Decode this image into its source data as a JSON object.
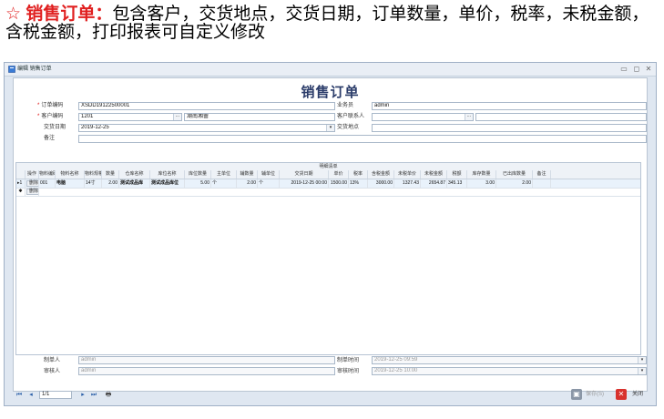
{
  "caption": {
    "star": "☆",
    "keyword": "销售订单：",
    "text": "包含客户，交货地点，交货日期，订单数量，单价，税率，未税金额，含税金额，打印报表可自定义修改"
  },
  "window": {
    "title": "编辑 销售订单",
    "form_title": "销售订单"
  },
  "fields": {
    "order_no_label": "订单编码",
    "order_no_value": "XSDD19122500001",
    "customer_code_label": "客户编码",
    "customer_code_value": "1201",
    "customer_name_value": "湖南湘蕾",
    "delivery_date_label": "交货日期",
    "delivery_date_value": "2019-12-25",
    "remark_label": "备注",
    "salesman_label": "业务员",
    "salesman_value": "admin",
    "contact_label": "客户联系人",
    "delivery_place_label": "交货地点"
  },
  "grid": {
    "caption": "明细清单",
    "columns": [
      "操作",
      "物料编码",
      "物料名称",
      "物料规格",
      "数量",
      "仓库名称",
      "库位名称",
      "库位数量",
      "主单位",
      "辅数量",
      "辅单位",
      "交货日期",
      "单价",
      "税率",
      "含税金额",
      "未税单价",
      "未税金额",
      "税额",
      "库存数量",
      "已出库数量",
      "备注"
    ],
    "delete_label": "删除",
    "rows": [
      {
        "indicator": "▸1",
        "material_code": "001",
        "material_name": "电脑",
        "spec": "14寸",
        "qty": "2.00",
        "warehouse": "测试成品库",
        "location": "测试成品库位",
        "loc_qty": "5.00",
        "unit": "个",
        "aux_qty": "2.00",
        "aux_unit": "个",
        "date": "2019-12-25 00:00",
        "price": "1500.00",
        "tax_rate": "13%",
        "amount_tax": "3000.00",
        "price_notax": "1327.43",
        "amount_notax": "2654.87",
        "tax": "345.13",
        "stock": "3.00",
        "out_qty": "2.00",
        "remark": ""
      }
    ],
    "new_row_indicator": "✱"
  },
  "footer_fields": {
    "creator_label": "制单人",
    "creator_value": "admin",
    "create_time_label": "制单时间",
    "create_time_value": "2019-12-25 09:59",
    "auditor_label": "审核人",
    "auditor_value": "admin",
    "audit_time_label": "审核时间",
    "audit_time_value": "2019-12-25 10:00"
  },
  "bottom": {
    "page_value": "1/1",
    "save_label": "保存(S)",
    "close_label": "关闭"
  }
}
